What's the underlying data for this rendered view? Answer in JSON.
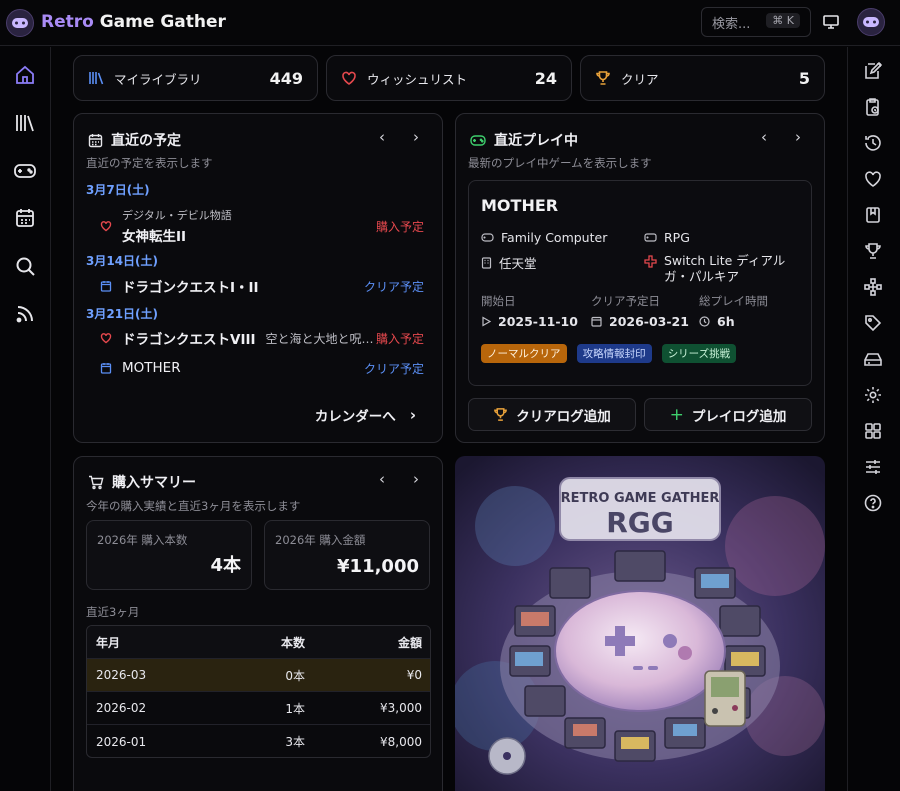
{
  "header": {
    "brand_accent": "Retro",
    "brand_rest": " Game Gather",
    "search_placeholder": "検索...",
    "search_shortcut": "⌘ K"
  },
  "leftbar": [
    "home-icon",
    "library-icon",
    "gamepad-icon",
    "calendar-icon",
    "search-icon",
    "rss-icon"
  ],
  "rightbar": [
    "note-edit-icon",
    "clipboard-clock-icon",
    "history-icon",
    "heart-icon",
    "bookmark-icon",
    "trophy-icon",
    "puzzle-icon",
    "tag-icon",
    "drive-icon",
    "gear-icon",
    "grid-icon",
    "sliders-icon",
    "help-icon"
  ],
  "stats": [
    {
      "label": "マイライブラリ",
      "value": "449"
    },
    {
      "label": "ウィッシュリスト",
      "value": "24"
    },
    {
      "label": "クリア",
      "value": "5"
    }
  ],
  "schedule": {
    "title": "直近の予定",
    "subtitle": "直近の予定を表示します",
    "groups": [
      {
        "date": "3月7日(土)",
        "items": [
          {
            "series": "デジタル・デビル物語",
            "title": "女神転生II",
            "sub": "",
            "tag": "購入予定"
          }
        ]
      },
      {
        "date": "3月14日(土)",
        "items": [
          {
            "series": "",
            "title": "ドラゴンクエストI・II",
            "sub": "",
            "tag": "クリア予定"
          }
        ]
      },
      {
        "date": "3月21日(土)",
        "items": [
          {
            "series": "",
            "title": "ドラゴンクエストVIII",
            "sub": "空と海と大地と呪…",
            "tag": "購入予定"
          },
          {
            "series": "",
            "title": "MOTHER",
            "sub": "",
            "tag": "クリア予定"
          }
        ]
      }
    ],
    "calendar_link": "カレンダーへ"
  },
  "playing": {
    "title": "直近プレイ中",
    "subtitle": "最新のプレイ中ゲームを表示します",
    "game": "MOTHER",
    "platform": "Family Computer",
    "genre": "RPG",
    "publisher": "任天堂",
    "device": "Switch Lite ディアルガ・パルキア",
    "start_label": "開始日",
    "start_value": "2025-11-10",
    "clear_label": "クリア予定日",
    "clear_value": "2026-03-21",
    "time_label": "総プレイ時間",
    "time_value": "6h",
    "tags": [
      {
        "label": "ノーマルクリア",
        "bg": "#b8660b",
        "fg": "#fff3e0"
      },
      {
        "label": "攻略情報封印",
        "bg": "#1e3a8a",
        "fg": "#c9d8ff"
      },
      {
        "label": "シリーズ挑戦",
        "bg": "#0f5132",
        "fg": "#c8f2d8"
      }
    ],
    "btn_clear_log": "クリアログ追加",
    "btn_play_log": "プレイログ追加"
  },
  "purchase": {
    "title": "購入サマリー",
    "subtitle": "今年の購入実績と直近3ヶ月を表示します",
    "count_label": "2026年 購入本数",
    "count_value": "4本",
    "amount_label": "2026年 購入金額",
    "amount_value": "¥11,000",
    "recent_label": "直近3ヶ月",
    "headers": [
      "年月",
      "本数",
      "金額"
    ],
    "rows": [
      [
        "2026-03",
        "0本",
        "¥0"
      ],
      [
        "2026-02",
        "1本",
        "¥3,000"
      ],
      [
        "2026-01",
        "3本",
        "¥8,000"
      ]
    ]
  },
  "artwork": {
    "banner_line1": "RETRO GAME GATHER",
    "banner_line2": "RGG"
  },
  "colors": {
    "accent": "#a98bf5",
    "red": "#e5484d",
    "blue": "#5b8ff5",
    "trophy": "#e8a13a",
    "green": "#3ecf6d"
  }
}
